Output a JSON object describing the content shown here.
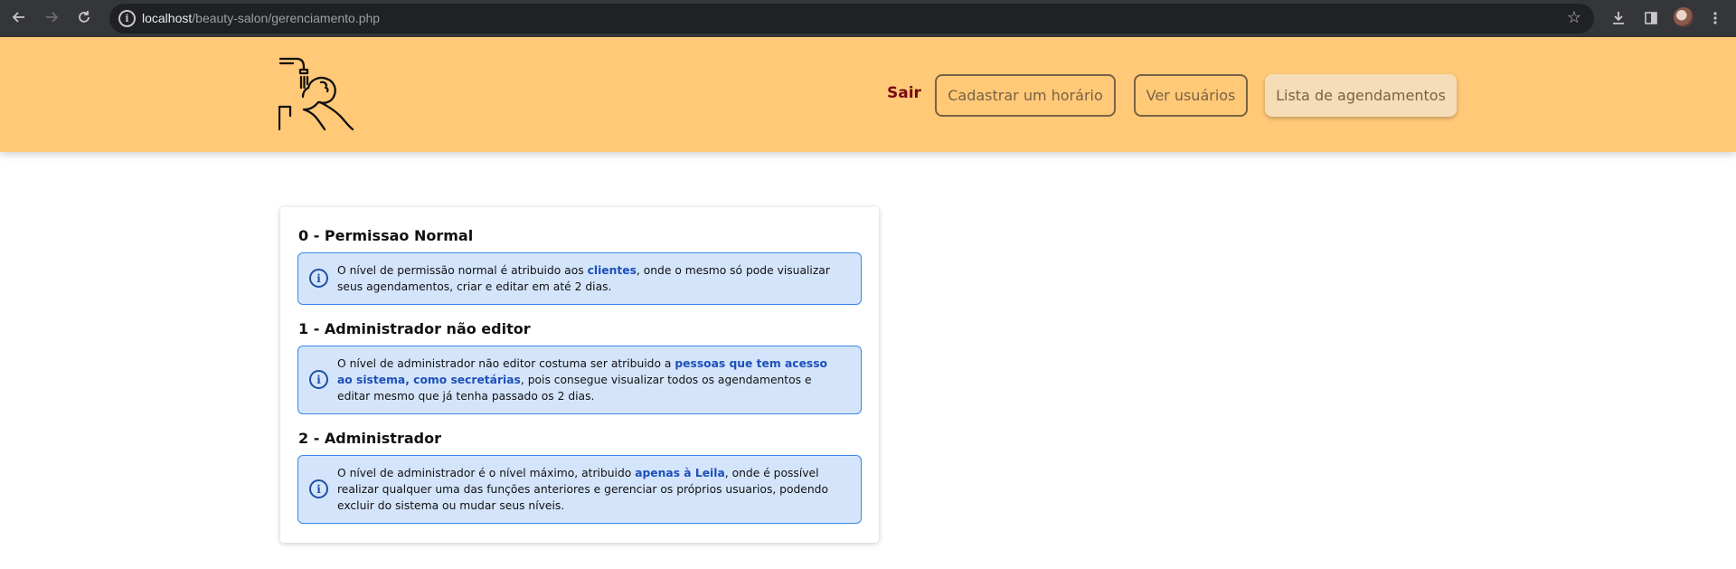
{
  "browser": {
    "url_host": "localhost",
    "url_path": "/beauty-salon/gerenciamento.php",
    "icons": [
      "back-icon",
      "forward-icon",
      "reload-icon",
      "info-icon",
      "star-icon",
      "download-icon",
      "side-panel-icon",
      "profile-avatar",
      "menu-kebab-icon"
    ]
  },
  "header": {
    "logo_icon": "salon-hair-wash-icon",
    "nav": {
      "sair": "Sair",
      "cadastrar": "Cadastrar um horário",
      "ver_usuarios": "Ver usuários",
      "lista": "Lista de agendamentos"
    },
    "colors": {
      "header_bg": "#ffc978",
      "sair": "#7a0a14",
      "button_text": "#7a6244",
      "active_button_bg": "#f5deb7"
    }
  },
  "permissions": {
    "level0": {
      "title": "0 - Permissao Normal",
      "text_before": "O nível de permissão normal é atribuido aos ",
      "highlight": "clientes",
      "text_after": ", onde o mesmo só pode visualizar seus agendamentos, criar e editar em até 2 dias."
    },
    "level1": {
      "title": "1 - Administrador não editor",
      "text_before": "O nível de administrador não editor costuma ser atribuido a ",
      "highlight": "pessoas que tem acesso ao sistema, como secretárias",
      "text_after": ", pois consegue visualizar todos os agendamentos e editar mesmo que já tenha passado os 2 dias."
    },
    "level2": {
      "title": "2 - Administrador",
      "text_before": "O nível de administrador é o nível máximo, atribuido ",
      "highlight": "apenas à Leila",
      "text_after": ", onde é possível realizar qualquer uma das funções anteriores e gerenciar os próprios usuarios, podendo excluir do sistema ou mudar seus níveis."
    },
    "colors": {
      "alert_bg": "#d4e5fb",
      "alert_border": "#3b86e8",
      "highlight": "#1d4fb8"
    }
  }
}
